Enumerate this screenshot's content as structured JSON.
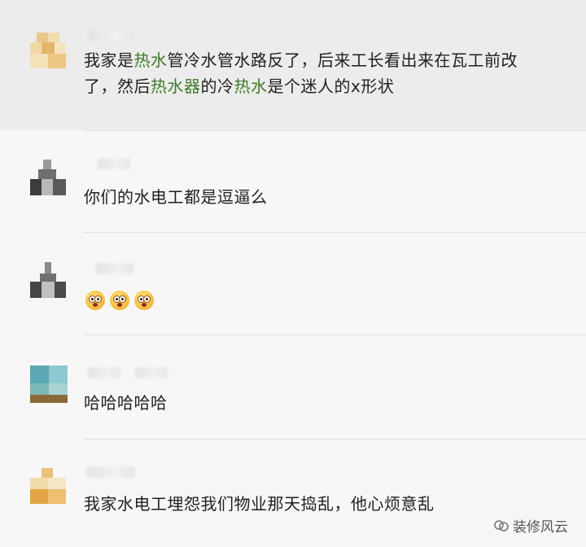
{
  "comments": [
    {
      "segments": [
        {
          "text": "我家是"
        },
        {
          "text": "热水",
          "hl": true
        },
        {
          "text": "管冷水管水路反了，后来工长看出来在瓦工前改了，然后"
        },
        {
          "text": "热水器",
          "hl": true
        },
        {
          "text": "的冷"
        },
        {
          "text": "热水",
          "hl": true
        },
        {
          "text": "是个迷人的x形状"
        }
      ]
    },
    {
      "text": "你们的水电工都是逗逼么"
    },
    {
      "emojis": [
        "flushed-emoji",
        "flushed-emoji",
        "flushed-emoji"
      ]
    },
    {
      "text": "哈哈哈哈哈"
    },
    {
      "text": "我家水电工埋怨我们物业那天捣乱，他心烦意乱"
    }
  ],
  "watermark": {
    "text": "装修风云",
    "icon": "wechat-official-account-icon"
  },
  "colors": {
    "highlight": "#3f7b2a",
    "text": "#1f1f1f",
    "selected_bg": "#ececec",
    "bg": "#f7f7f7"
  }
}
